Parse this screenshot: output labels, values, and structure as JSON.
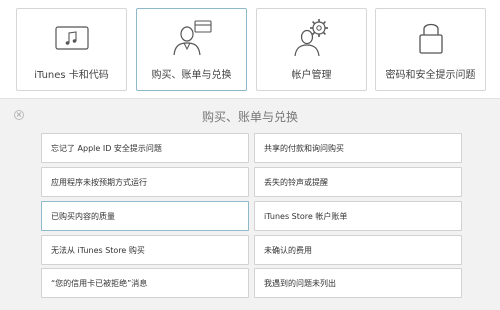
{
  "categories": [
    {
      "label": "iTunes 卡和代码",
      "icon": "music-card-icon"
    },
    {
      "label": "购买、账单与兑换",
      "icon": "purchase-user-card-icon",
      "active": true
    },
    {
      "label": "帐户管理",
      "icon": "account-gear-user-icon"
    },
    {
      "label": "密码和安全提示问题",
      "icon": "padlock-icon"
    }
  ],
  "panel": {
    "title": "购买、账单与兑换",
    "close_icon": "close-icon",
    "left_options": [
      "忘记了 Apple ID 安全提示问题",
      "应用程序未按预期方式运行",
      "已购买内容的质量",
      "无法从 iTunes Store 购买",
      "“您的信用卡已被拒绝”消息"
    ],
    "right_options": [
      "共享的付款和询问购买",
      "丢失的铃声或提醒",
      "iTunes Store 帐户账单",
      "未确认的费用",
      "我遇到的问题未列出"
    ],
    "active_option": "已购买内容的质量"
  },
  "colors": {
    "accent_border": "#8fb9c9",
    "panel_bg": "#f2f2f2"
  }
}
